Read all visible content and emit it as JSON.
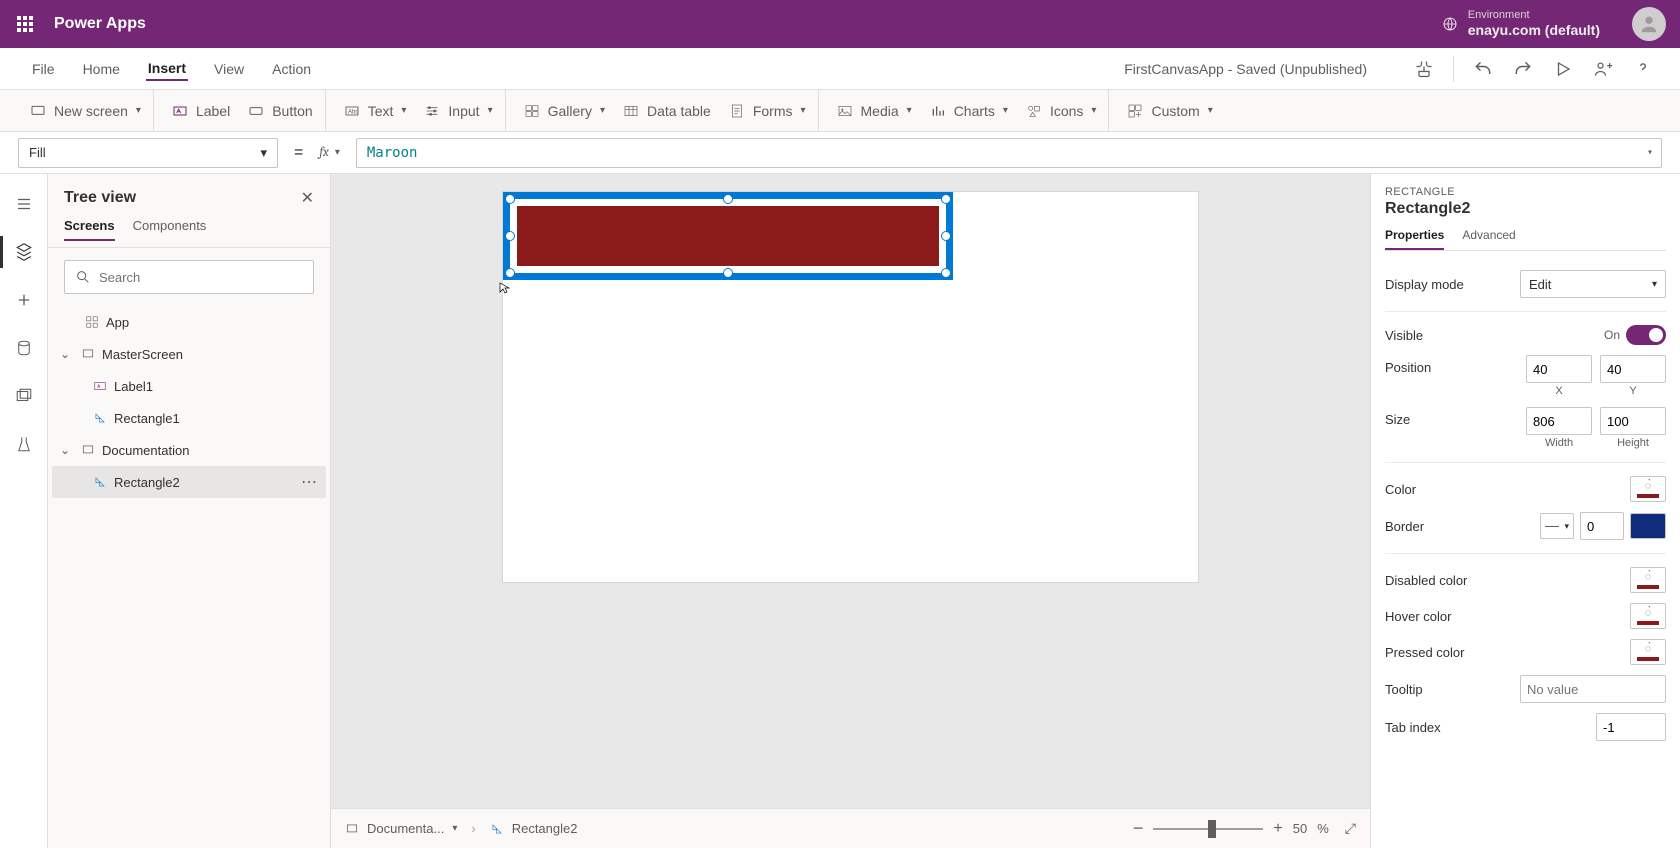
{
  "header": {
    "app_title": "Power Apps",
    "env_label": "Environment",
    "env_name": "enayu.com (default)"
  },
  "menu": {
    "items": [
      "File",
      "Home",
      "Insert",
      "View",
      "Action"
    ],
    "active_index": 2,
    "app_state": "FirstCanvasApp - Saved (Unpublished)"
  },
  "ribbon": {
    "new_screen": "New screen",
    "label": "Label",
    "button": "Button",
    "text": "Text",
    "input": "Input",
    "gallery": "Gallery",
    "data_table": "Data table",
    "forms": "Forms",
    "media": "Media",
    "charts": "Charts",
    "icons": "Icons",
    "custom": "Custom"
  },
  "formula": {
    "property": "Fill",
    "equals": "=",
    "fx": "fx",
    "expression": "Maroon"
  },
  "tree": {
    "title": "Tree view",
    "tab_screens": "Screens",
    "tab_components": "Components",
    "search_placeholder": "Search",
    "app": "App",
    "master": "MasterScreen",
    "label1": "Label1",
    "rect1": "Rectangle1",
    "documentation": "Documentation",
    "rect2": "Rectangle2"
  },
  "canvas_footer": {
    "screen": "Documenta...",
    "element": "Rectangle2",
    "zoom": "50",
    "zoom_suffix": "%"
  },
  "props": {
    "category": "RECTANGLE",
    "name": "Rectangle2",
    "tab_properties": "Properties",
    "tab_advanced": "Advanced",
    "display_mode_label": "Display mode",
    "display_mode_value": "Edit",
    "visible_label": "Visible",
    "visible_value": "On",
    "position_label": "Position",
    "x": "40",
    "y": "40",
    "x_sub": "X",
    "y_sub": "Y",
    "size_label": "Size",
    "w": "806",
    "h": "100",
    "w_sub": "Width",
    "h_sub": "Height",
    "color_label": "Color",
    "border_label": "Border",
    "border_value": "0",
    "disabled_color_label": "Disabled color",
    "hover_color_label": "Hover color",
    "pressed_color_label": "Pressed color",
    "tooltip_label": "Tooltip",
    "tooltip_placeholder": "No value",
    "tabindex_label": "Tab index",
    "tabindex_value": "-1",
    "fill_color": "#8b1a1a",
    "border_color": "#0f2d7a"
  }
}
